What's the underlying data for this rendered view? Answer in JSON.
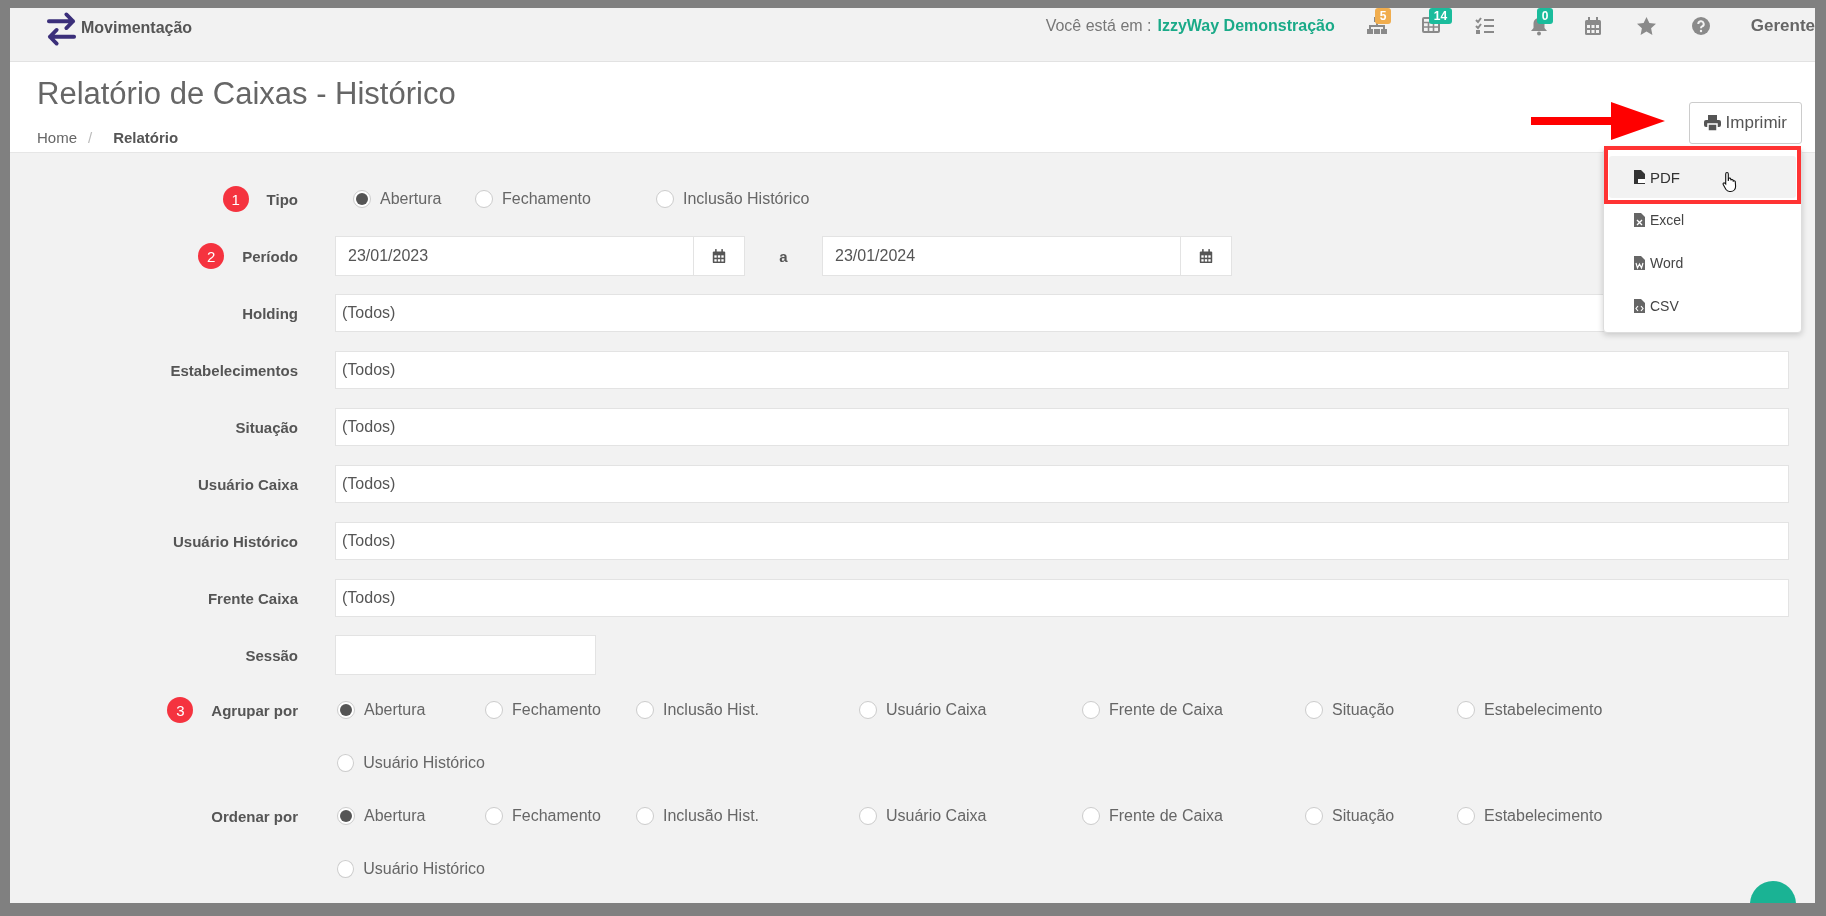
{
  "topbar": {
    "module": "Movimentação",
    "location_label": "Você está em :",
    "location": "IzzyWay Demonstração",
    "icons": [
      {
        "kind": "hierarchy",
        "badge": "5",
        "color": "#f0ad4e"
      },
      {
        "kind": "grid",
        "badge": "14",
        "color": "#1abc9c"
      },
      {
        "kind": "checklist"
      },
      {
        "kind": "bell",
        "badge": "0",
        "color": "#1abc9c"
      },
      {
        "kind": "calendar"
      },
      {
        "kind": "star"
      },
      {
        "kind": "help"
      }
    ],
    "user": "Gerente"
  },
  "page": {
    "title": "Relatório de Caixas - Histórico",
    "breadcrumb_separator": "/",
    "breadcrumb": [
      {
        "label": "Home",
        "current": false
      },
      {
        "label": "Relatório",
        "current": true
      }
    ]
  },
  "print_button": {
    "label": "Imprimir"
  },
  "print_menu": [
    {
      "label": "PDF",
      "kind": "pdf",
      "highlighted": true
    },
    {
      "label": "Excel",
      "kind": "excel",
      "highlighted": false
    },
    {
      "label": "Word",
      "kind": "word",
      "highlighted": false
    },
    {
      "label": "CSV",
      "kind": "csv",
      "highlighted": false
    }
  ],
  "form": [
    {
      "kind": "radio",
      "label": "Tipo",
      "marker": "1",
      "options": [
        {
          "label": "Abertura",
          "selected": true
        },
        {
          "label": "Fechamento",
          "selected": false
        },
        {
          "label": "Inclusão Histórico",
          "selected": false
        }
      ]
    },
    {
      "kind": "period",
      "label": "Período",
      "marker": "2",
      "from": "23/01/2023",
      "separator": "a",
      "to": "23/01/2024"
    },
    {
      "kind": "select",
      "label": "Holding",
      "value": "(Todos)"
    },
    {
      "kind": "select",
      "label": "Estabelecimentos",
      "value": "(Todos)"
    },
    {
      "kind": "select",
      "label": "Situação",
      "value": "(Todos)"
    },
    {
      "kind": "select",
      "label": "Usuário Caixa",
      "value": "(Todos)"
    },
    {
      "kind": "select",
      "label": "Usuário Histórico",
      "value": "(Todos)"
    },
    {
      "kind": "select",
      "label": "Frente Caixa",
      "value": "(Todos)"
    },
    {
      "kind": "text",
      "label": "Sessão"
    },
    {
      "kind": "radio-grid",
      "label": "Agrupar por",
      "marker": "3",
      "options": [
        {
          "label": "Abertura",
          "selected": true
        },
        {
          "label": "Fechamento",
          "selected": false
        },
        {
          "label": "Inclusão Hist.",
          "selected": false
        },
        {
          "label": "Usuário Caixa",
          "selected": false
        },
        {
          "label": "Frente de Caixa",
          "selected": false
        },
        {
          "label": "Situação",
          "selected": false
        },
        {
          "label": "Estabelecimento",
          "selected": false
        },
        {
          "label": "Usuário Histórico",
          "selected": false
        }
      ]
    },
    {
      "kind": "radio-grid",
      "label": "Ordenar por",
      "options": [
        {
          "label": "Abertura",
          "selected": true
        },
        {
          "label": "Fechamento",
          "selected": false
        },
        {
          "label": "Inclusão Hist.",
          "selected": false
        },
        {
          "label": "Usuário Caixa",
          "selected": false
        },
        {
          "label": "Frente de Caixa",
          "selected": false
        },
        {
          "label": "Situação",
          "selected": false
        },
        {
          "label": "Estabelecimento",
          "selected": false
        },
        {
          "label": "Usuário Histórico",
          "selected": false
        }
      ]
    }
  ]
}
